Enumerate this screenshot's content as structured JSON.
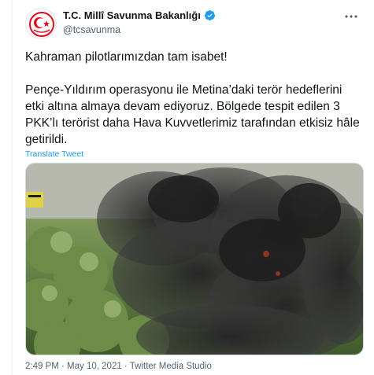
{
  "tweet": {
    "author_name": "T.C. Millî Savunma Bakanlığı",
    "author_handle": "@tcsavunma",
    "paragraph1": "Kahraman pilotlarımızdan tam isabet!",
    "paragraph2": "Pençe-Yıldırım operasyonu ile Metina’daki terör hedeflerini etki altına almaya devam ediyoruz. Bölgede tespit edilen 3 PKK’lı terörist daha Hava Kuvvetlerimiz tarafından etkisiz hâle getirildi.",
    "translate_link": "Translate Tweet",
    "timestamp": "2:49 PM · May 10, 2021 · Twitter Media Studio"
  },
  "icons": {
    "avatar": "ministry-emblem-icon",
    "verified": "verified-badge-icon",
    "more": "more-options-icon"
  },
  "colors": {
    "accent": "#1d9bf0",
    "secondary_text": "#536471",
    "emblem_red": "#e30a17"
  }
}
